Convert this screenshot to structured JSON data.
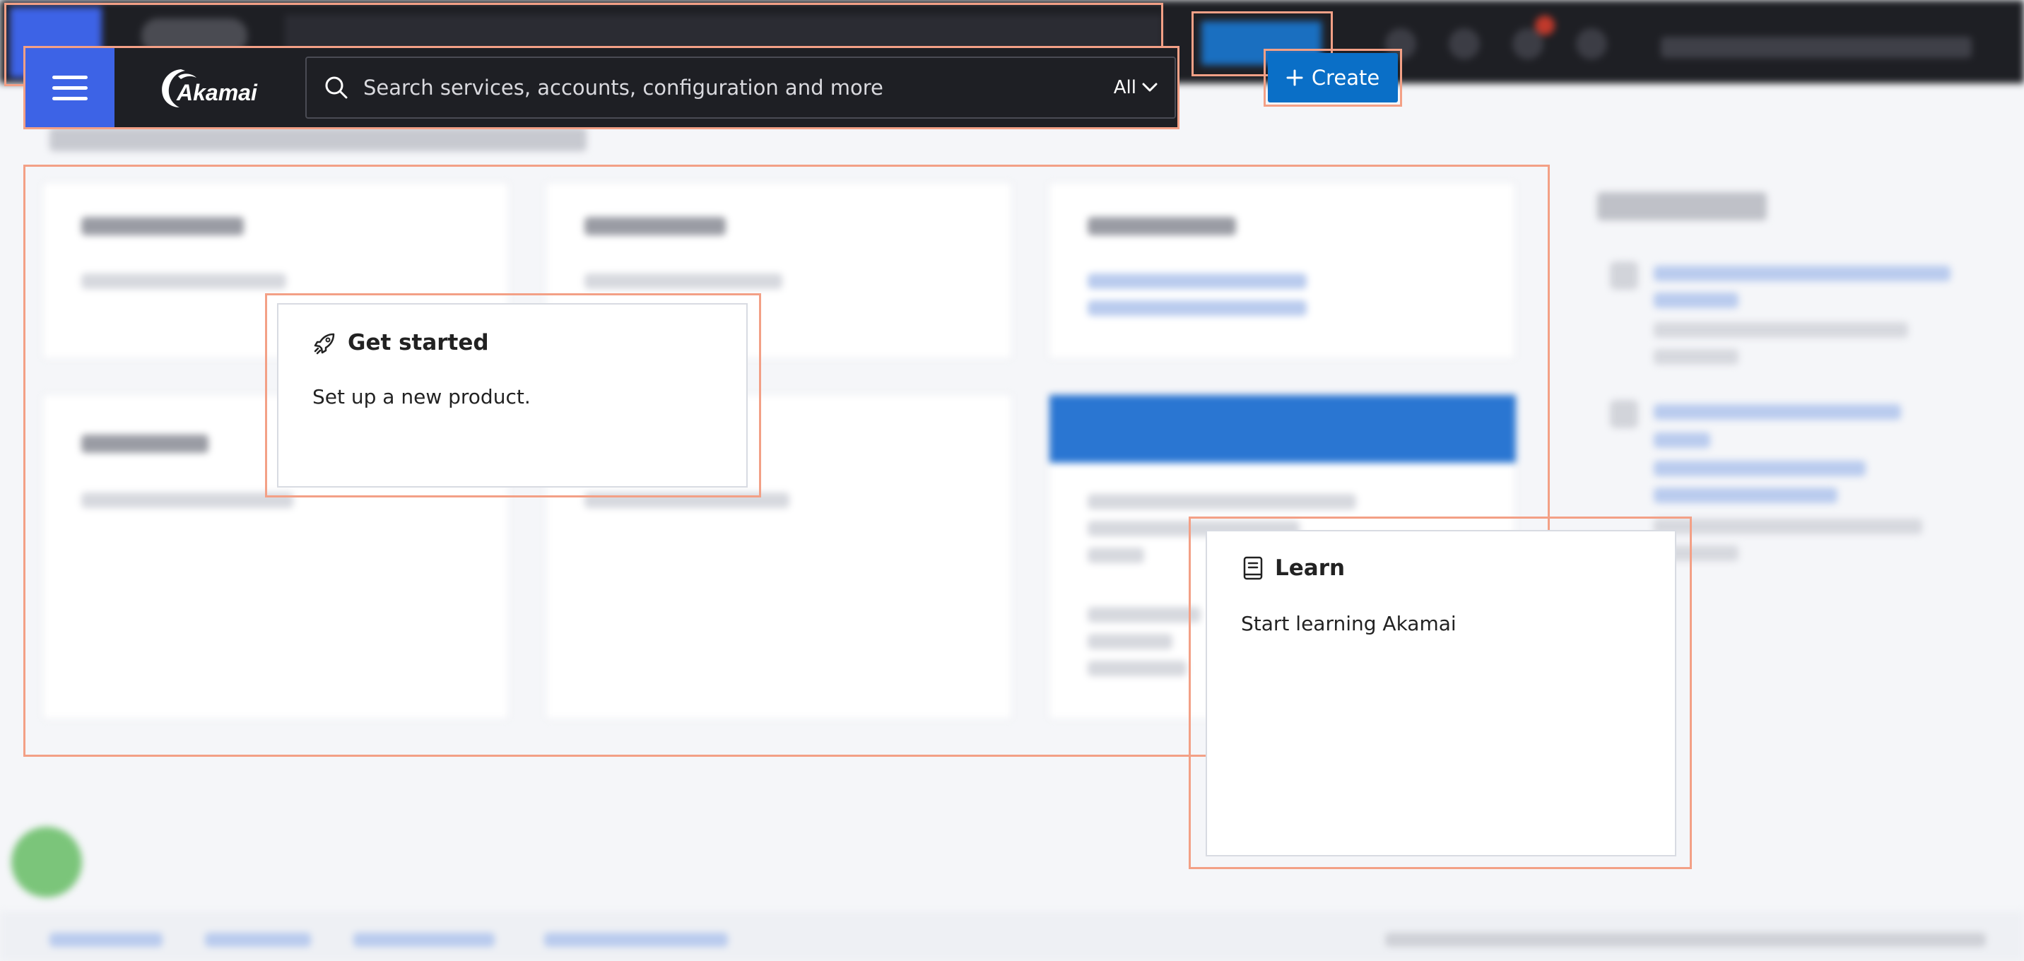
{
  "header": {
    "logo_text": "Akamai",
    "search_placeholder": "Search services, accounts, configuration and more",
    "search_scope": "All",
    "create_label": "Create"
  },
  "popups": {
    "get_started": {
      "title": "Get started",
      "description": "Set up a new product."
    },
    "learn": {
      "title": "Learn",
      "description": "Start learning Akamai"
    }
  },
  "colors": {
    "nav_background": "#1e1f24",
    "menu_accent": "#3d63e6",
    "create_button": "#0a6fc7",
    "highlight_border": "#f3a086"
  },
  "icons": {
    "menu": "hamburger-menu-icon",
    "search": "search-icon",
    "scope": "chevron-down-icon",
    "create": "plus-icon",
    "get_started": "rocket-icon",
    "learn": "book-icon"
  }
}
